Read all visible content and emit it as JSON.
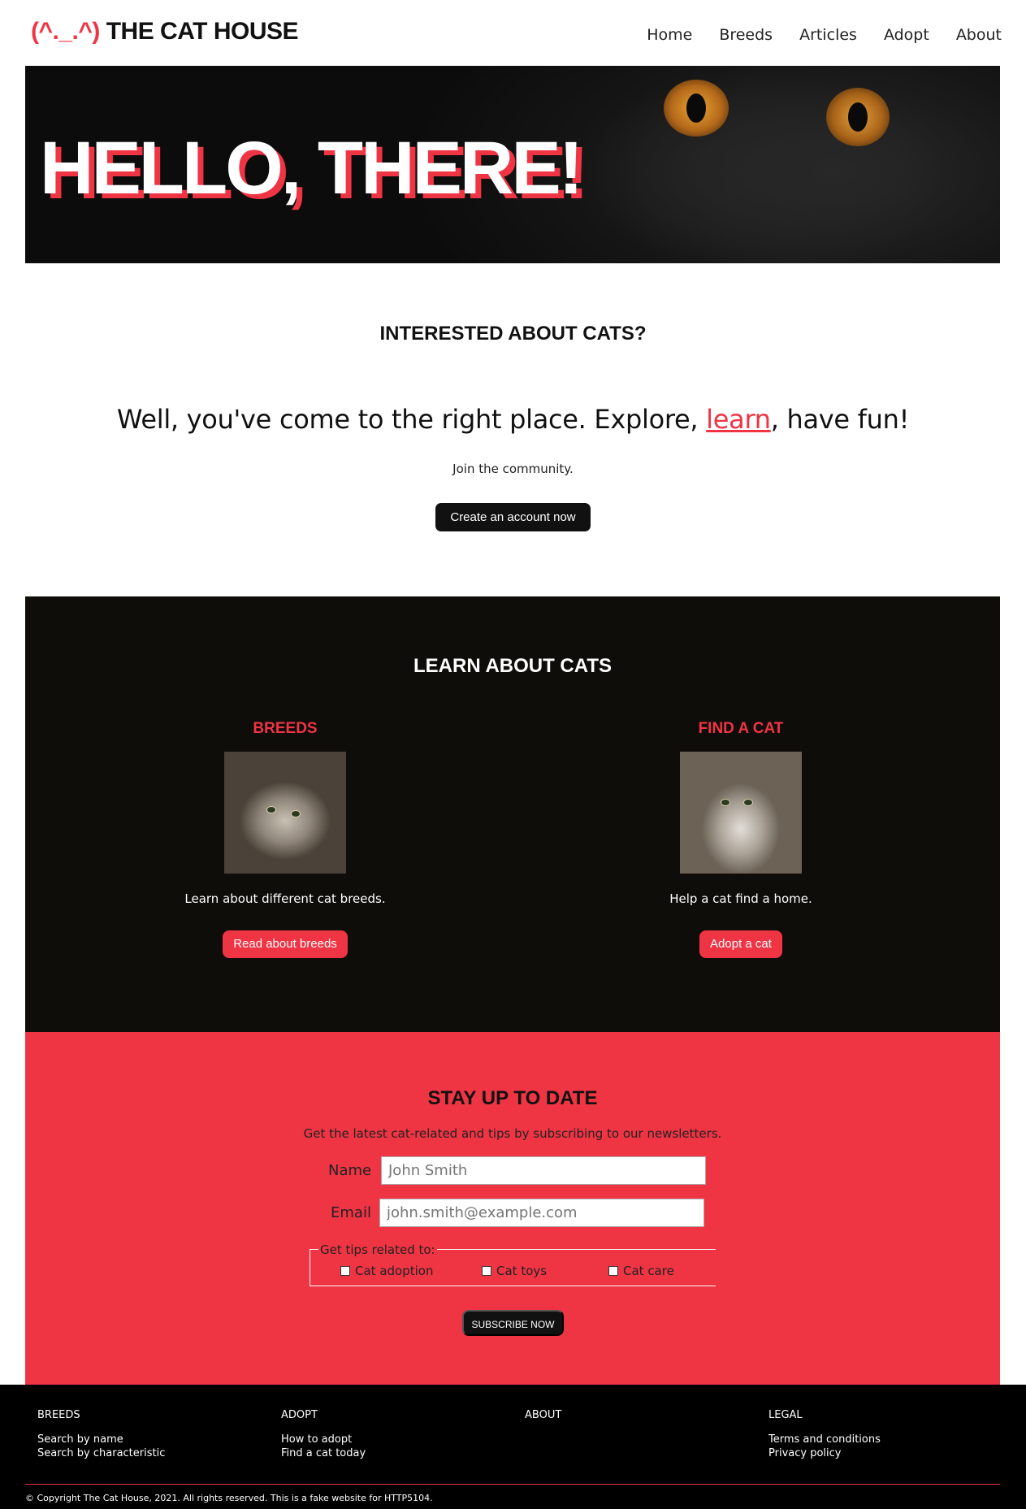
{
  "header": {
    "logo_face": "(^._.^)",
    "logo_name": "THE CAT HOUSE",
    "nav": [
      "Home",
      "Breeds",
      "Articles",
      "Adopt",
      "About"
    ]
  },
  "hero": {
    "title": "HELLO, THERE!"
  },
  "intro": {
    "heading": "INTERESTED ABOUT CATS?",
    "tagline_pre": "Well, you've come to the right place. Explore, ",
    "tagline_link": "learn",
    "tagline_post": ", have fun!",
    "join": "Join the community.",
    "cta": "Create an account now"
  },
  "learn": {
    "heading": "LEARN ABOUT CATS",
    "cards": [
      {
        "title": "BREEDS",
        "text": "Learn about different cat breeds.",
        "button": "Read about breeds"
      },
      {
        "title": "FIND A CAT",
        "text": "Help a cat find a home.",
        "button": "Adopt a cat"
      }
    ]
  },
  "newsletter": {
    "heading": "STAY UP TO DATE",
    "subtext": "Get the latest cat-related and tips by subscribing to our newsletters.",
    "name_label": "Name",
    "name_placeholder": "John Smith",
    "email_label": "Email",
    "email_placeholder": "john.smith@example.com",
    "legend": "Get tips related to:",
    "options": [
      "Cat adoption",
      "Cat toys",
      "Cat care"
    ],
    "submit": "SUBSCRIBE NOW"
  },
  "footer": {
    "columns": [
      {
        "title": "BREEDS",
        "links": [
          "Search by name",
          "Search by characteristic"
        ]
      },
      {
        "title": "ADOPT",
        "links": [
          "How to adopt",
          "Find a cat today"
        ]
      },
      {
        "title": "ABOUT",
        "links": []
      },
      {
        "title": "LEGAL",
        "links": [
          "Terms and conditions",
          "Privacy policy"
        ]
      }
    ],
    "copyright": "© Copyright The Cat House, 2021. All rights reserved. This is a fake website for HTTP5104."
  },
  "colors": {
    "accent": "#ef3444",
    "dark": "#0f0d0a",
    "black": "#000000"
  }
}
